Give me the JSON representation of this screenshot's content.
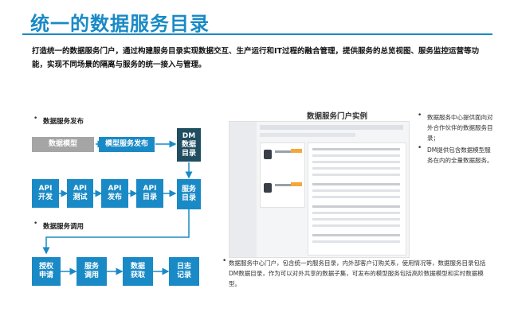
{
  "header": {
    "title": "统一的数据服务目录",
    "intro": "打造统一的数据服务门户，通过构建服务目录实现数据交互、生产运行和IT过程的融合管理，提供服务的总览视图、服务监控运营等功能，实现不同场景的隔离与服务的统一接入与管理。"
  },
  "publish": {
    "heading": "数据服务发布",
    "data_model": "数据模型",
    "model_publish": "模型服务发布",
    "dm_catalog": [
      "DM",
      "数据",
      "目录"
    ],
    "api_dev": [
      "API",
      "开发"
    ],
    "api_test": [
      "API",
      "测试"
    ],
    "api_publish": [
      "API",
      "发布"
    ],
    "api_catalog": [
      "API",
      "目录"
    ],
    "service_catalog": [
      "服务",
      "目录"
    ]
  },
  "invoke": {
    "heading": "数据服务调用",
    "auth": [
      "授权",
      "申请"
    ],
    "svc_call": [
      "服务",
      "调用"
    ],
    "data_get": [
      "数据",
      "获取"
    ],
    "log": [
      "日志",
      "记录"
    ]
  },
  "portal": {
    "title": "数据服务门户实例",
    "right_bullet_1": "数据服务中心提供面向对外合作伙伴的数据服务目录；",
    "right_bullet_2": "DM提供包含数据模型服务在内的全量数据服务。",
    "bottom_bullet": "数据服务中心门户，包含统一的服务目录，内外部客户订购关系，使用情况等，数据服务目录包括DM数据目录，作为可以对外共享的数据子集，可发布的模型服务包括高阶数据模型和实时数据模型。"
  },
  "colors": {
    "accent": "#1a8ac6",
    "gray_box": "#a5a5a5",
    "dark_box": "#1f4e60"
  }
}
